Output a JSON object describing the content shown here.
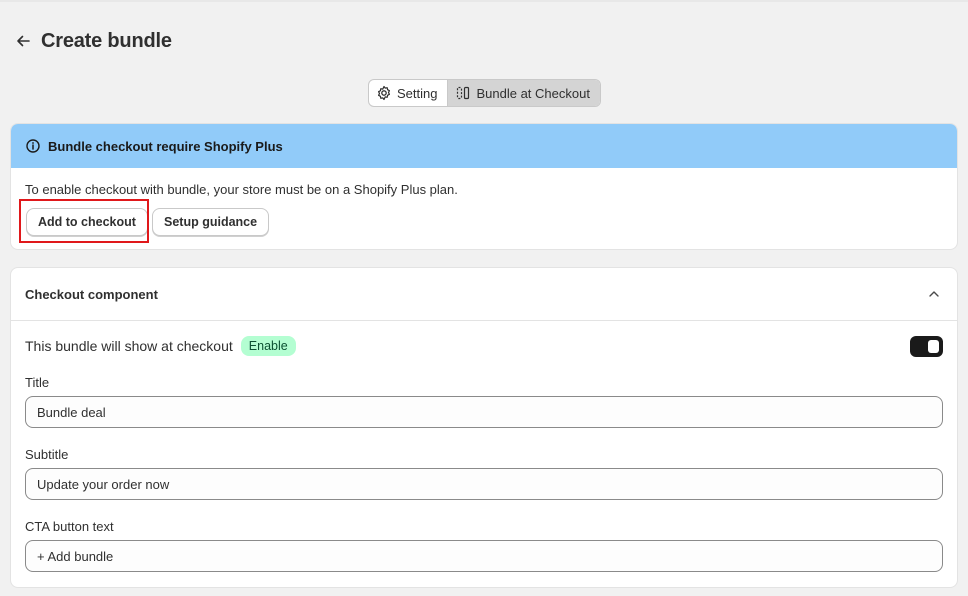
{
  "header": {
    "title": "Create bundle"
  },
  "tabs": [
    {
      "label": "Setting",
      "icon": "gear-icon",
      "active": false
    },
    {
      "label": "Bundle at Checkout",
      "icon": "bundle-checkout-icon",
      "active": true
    }
  ],
  "banner": {
    "title": "Bundle checkout require Shopify Plus",
    "text": "To enable checkout with bundle, your store must be on a Shopify Plus plan.",
    "add_button": "Add to checkout",
    "setup_button": "Setup guidance",
    "color": "#91cbf9"
  },
  "component": {
    "title": "Checkout component",
    "show_label": "This bundle will show at checkout",
    "status_badge": "Enable",
    "toggle_on": true,
    "fields": {
      "title_label": "Title",
      "title_value": "Bundle deal",
      "subtitle_label": "Subtitle",
      "subtitle_value": "Update your order now",
      "cta_label": "CTA button text",
      "cta_value": "+ Add bundle"
    }
  },
  "colors": {
    "highlight": "#e0181b",
    "badge_bg": "#b4fed2",
    "toggle": "#1a1a1a"
  }
}
